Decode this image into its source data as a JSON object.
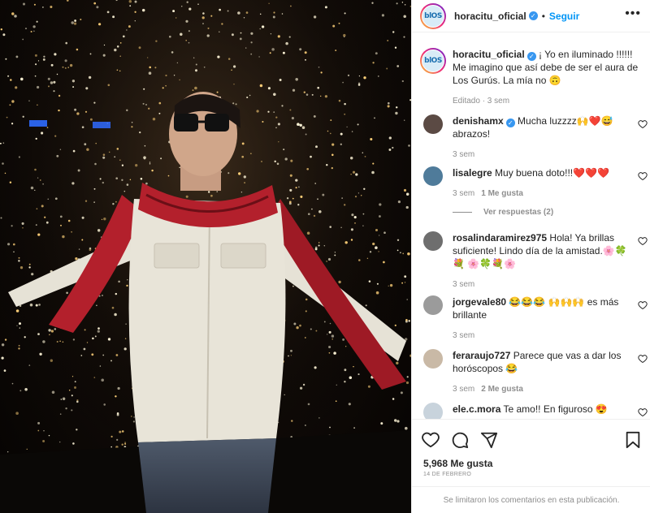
{
  "post": {
    "photo_alt": "Hombre con bufanda roja en túnel de luces",
    "author": "horacitu_oficial",
    "avatar_text": "blOS",
    "follow_label": "Seguir",
    "more_label": "•••",
    "caption_text": "¡ Yo en iluminado !!!!!! Me imagino que así debe de ser el aura de Los Gurús. La mía no 🙃",
    "caption_meta": "Editado · 3 sem"
  },
  "comments": [
    {
      "user": "denishamx",
      "verified": true,
      "text": "Mucha luzzzz🙌❤️😅 abrazos!",
      "time": "3 sem",
      "likes": ""
    },
    {
      "user": "lisalegre",
      "verified": false,
      "text": "Muy buena doto!!!❤️❤️❤️",
      "time": "3 sem",
      "likes": "1 Me gusta"
    },
    {
      "user": "rosalindaramirez975",
      "verified": false,
      "text": "Hola! Ya brillas suficiente! Lindo día de la amistad.🌸🍀💐 🌸🍀💐🌸",
      "time": "3 sem",
      "likes": ""
    },
    {
      "user": "jorgevale80",
      "verified": false,
      "text": "😂😂😂 🙌🙌🙌 es más brillante",
      "time": "3 sem",
      "likes": ""
    },
    {
      "user": "feraraujo727",
      "verified": false,
      "text": "Parece que vas a dar los horóscopos 😂",
      "time": "3 sem",
      "likes": "2 Me gusta"
    },
    {
      "user": "ele.c.mora",
      "verified": false,
      "text": "Te amo!! En figuroso 😍",
      "time": "",
      "likes": ""
    }
  ],
  "replies_label": "Ver respuestas (2)",
  "footer": {
    "likes": "5,968 Me gusta",
    "date": "14 DE FEBRERO",
    "comments_limited": "Se limitaron los comentarios en esta publicación."
  },
  "colors": {
    "accent": "#0095f6",
    "verified": "#3897f0",
    "muted": "#8e8e8e",
    "scarf": "#b3202c"
  }
}
